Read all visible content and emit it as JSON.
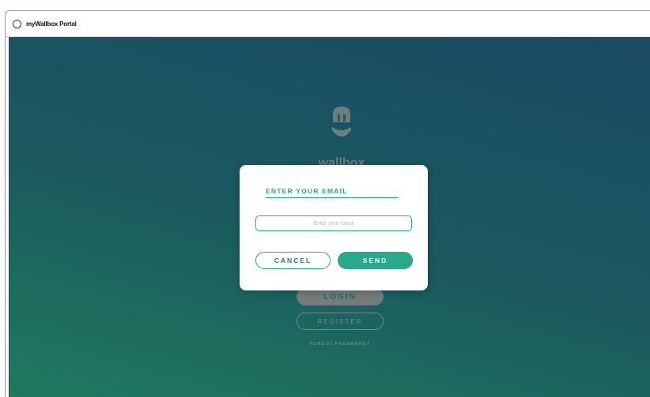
{
  "window": {
    "title": "myWallbox Portal",
    "app_icon": "circle-app-icon"
  },
  "background_page": {
    "logo_icon": "wallbox-plug-icon",
    "logo_text": "wallbox",
    "login_label": "LOGIN",
    "register_label": "REGISTER",
    "forgot_password_label": "FORGOT PASSWORD?"
  },
  "modal": {
    "title": "ENTER YOUR EMAIL",
    "email_value": "",
    "email_placeholder": "Enter your email",
    "cancel_label": "CANCEL",
    "send_label": "SEND"
  },
  "colors": {
    "accent": "#2aa88a",
    "background_gradient_start": "#1f7a5e",
    "background_gradient_end": "#1a4a64"
  }
}
